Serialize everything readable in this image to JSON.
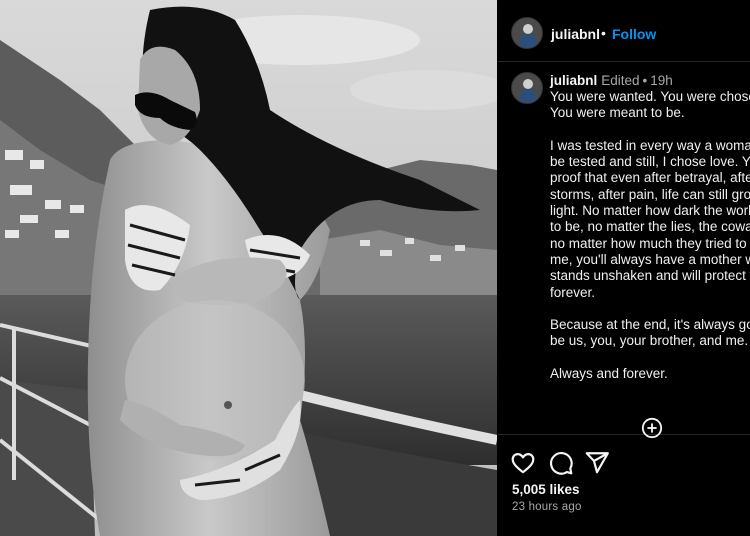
{
  "post": {
    "username": "juliabnl",
    "follow_label": "Follow",
    "header_separator": "•",
    "edited_label": "Edited",
    "time_separator": "•",
    "caption_time": "19h",
    "caption": "You were wanted. You were chosen. You were meant to be.\n\nI was tested in every way a woman can be tested and still, I chose love. You are proof that even after betrayal, after storms, after pain, life can still grow in light. No matter how dark the world tried to be, no matter the lies, the cowardice, no matter how much they tried to break me, you'll always have a mother who stands unshaken and will protect you forever.\n\nBecause at the end, it's always going to be us, you, your brother, and me.\n\nAlways and forever.",
    "likes": "5,005 likes",
    "time_ago": "23 hours ago"
  },
  "icons": {
    "like": "heart-icon",
    "comment": "comment-icon",
    "share": "share-icon",
    "more": "plus-circle-icon"
  },
  "colors": {
    "background": "#000000",
    "text": "#f5f5f5",
    "muted": "#a8a8a8",
    "link": "#0095f6",
    "divider": "#262626"
  }
}
